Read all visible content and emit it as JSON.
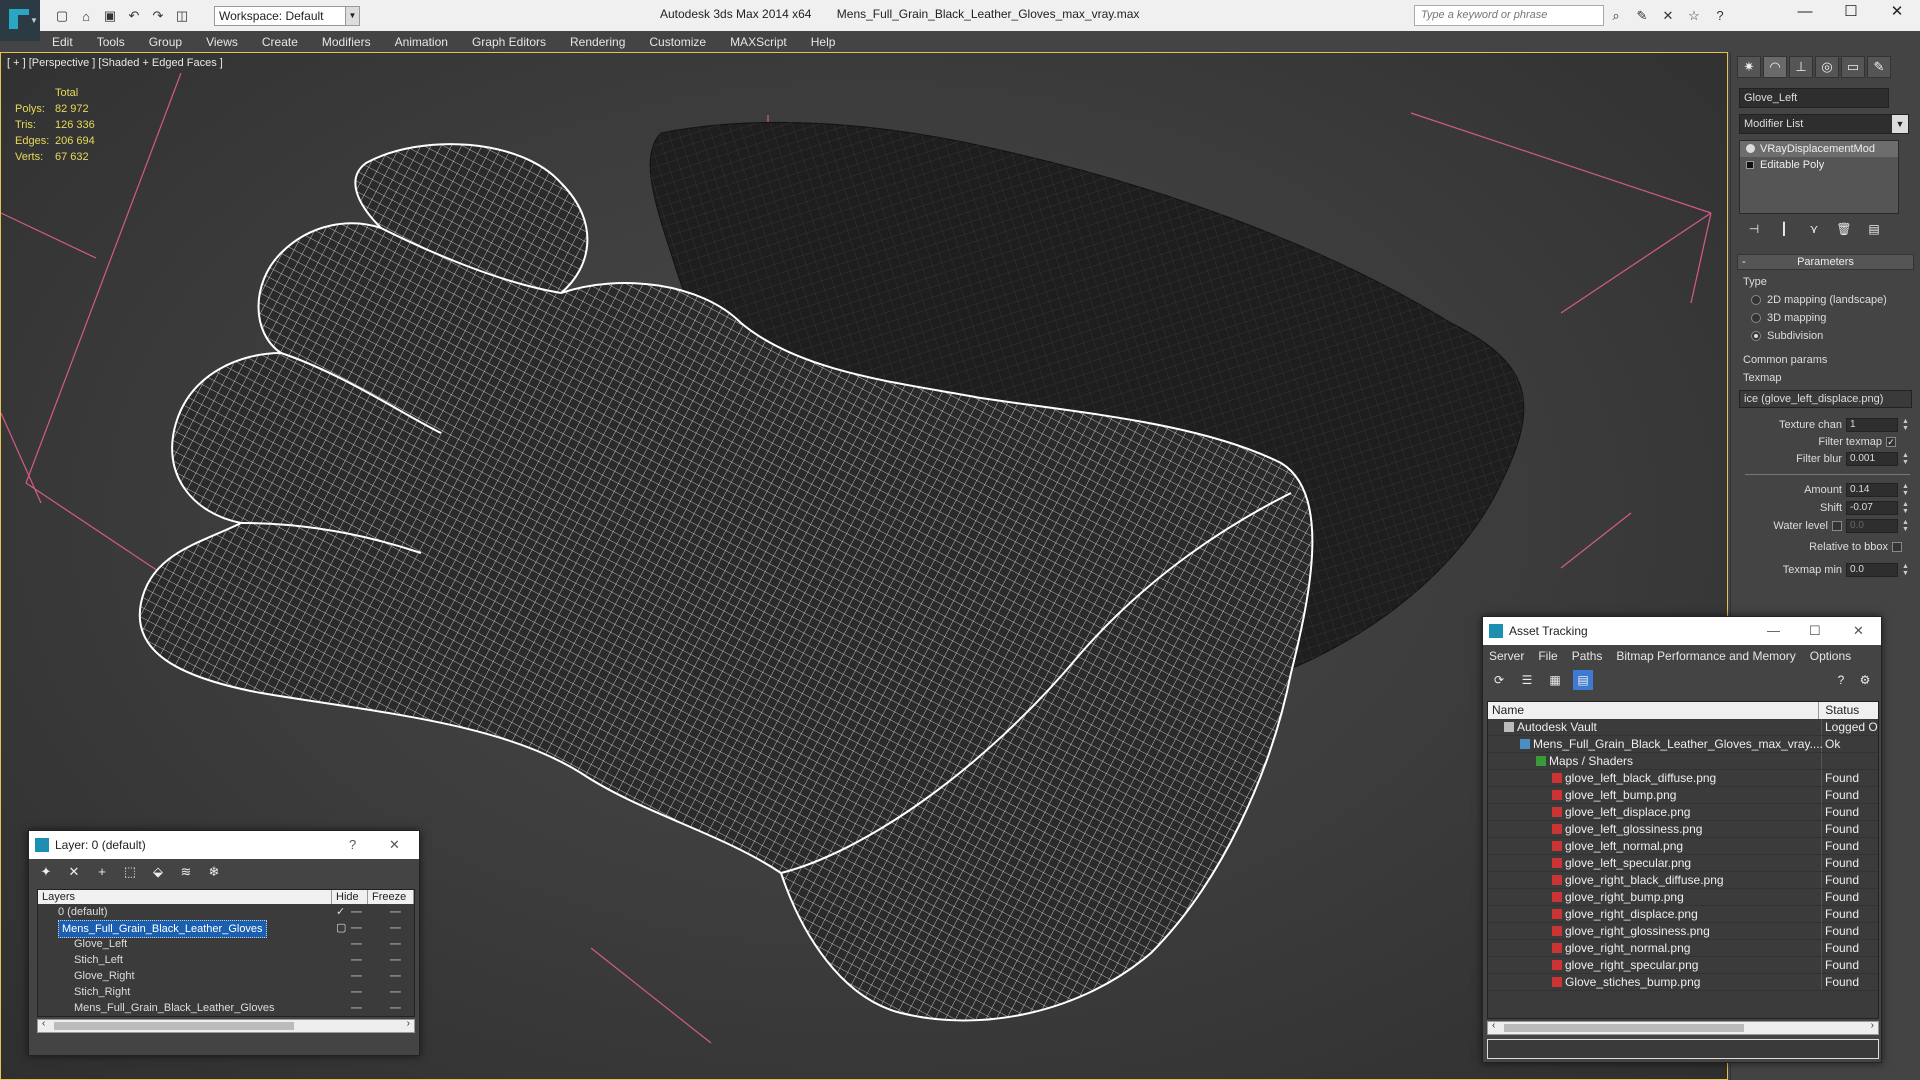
{
  "titlebar": {
    "workspace": "Workspace: Default",
    "app_name": "Autodesk 3ds Max  2014 x64",
    "file_name": "Mens_Full_Grain_Black_Leather_Gloves_max_vray.max",
    "search_placeholder": "Type a keyword or phrase"
  },
  "menu": [
    "Edit",
    "Tools",
    "Group",
    "Views",
    "Create",
    "Modifiers",
    "Animation",
    "Graph Editors",
    "Rendering",
    "Customize",
    "MAXScript",
    "Help"
  ],
  "viewport": {
    "label": "[ + ] [Perspective ] [Shaded + Edged Faces ]",
    "stats_header": "Total",
    "stats": [
      {
        "label": "Polys:",
        "value": "82 972"
      },
      {
        "label": "Tris:",
        "value": "126 336"
      },
      {
        "label": "Edges:",
        "value": "206 694"
      },
      {
        "label": "Verts:",
        "value": "67 632"
      }
    ]
  },
  "command_panel": {
    "object_name": "Glove_Left",
    "modifier_list": "Modifier List",
    "stack": [
      "VRayDisplacementMod",
      "Editable Poly"
    ],
    "parameters_title": "Parameters",
    "type_label": "Type",
    "type_options": [
      "2D mapping (landscape)",
      "3D mapping",
      "Subdivision"
    ],
    "common_params": "Common params",
    "texmap_label": "Texmap",
    "texmap_value": "ice (glove_left_displace.png)",
    "texture_chan_label": "Texture chan",
    "texture_chan_value": "1",
    "filter_texmap_label": "Filter texmap",
    "filter_blur_label": "Filter blur",
    "filter_blur_value": "0.001",
    "amount_label": "Amount",
    "amount_value": "0.14",
    "shift_label": "Shift",
    "shift_value": "-0.07",
    "water_level_label": "Water level",
    "water_level_value": "0.0",
    "relative_bbox_label": "Relative to bbox",
    "texmap_min_label": "Texmap min",
    "texmap_min_value": "0.0"
  },
  "layer_dialog": {
    "title": "Layer: 0 (default)",
    "help": "?",
    "columns": [
      "Layers",
      "Hide",
      "Freeze"
    ],
    "rows": [
      {
        "name": "0 (default)",
        "indent": 1
      },
      {
        "name": "Mens_Full_Grain_Black_Leather_Gloves",
        "indent": 1
      },
      {
        "name": "Glove_Left",
        "indent": 2
      },
      {
        "name": "Stich_Left",
        "indent": 2
      },
      {
        "name": "Glove_Right",
        "indent": 2
      },
      {
        "name": "Stich_Right",
        "indent": 2
      },
      {
        "name": "Mens_Full_Grain_Black_Leather_Gloves",
        "indent": 2
      }
    ]
  },
  "asset_dialog": {
    "title": "Asset Tracking",
    "menu": [
      "Server",
      "File",
      "Paths",
      "Bitmap Performance and Memory",
      "Options"
    ],
    "columns": [
      "Name",
      "Status"
    ],
    "rows": [
      {
        "name": "Autodesk Vault",
        "status": "Logged Ou",
        "icon": "vault",
        "indent": 1
      },
      {
        "name": "Mens_Full_Grain_Black_Leather_Gloves_max_vray....",
        "status": "Ok",
        "icon": "max",
        "indent": 2
      },
      {
        "name": "Maps / Shaders",
        "status": "",
        "icon": "map",
        "indent": 3
      },
      {
        "name": "glove_left_black_diffuse.png",
        "status": "Found",
        "icon": "png",
        "indent": 4
      },
      {
        "name": "glove_left_bump.png",
        "status": "Found",
        "icon": "png",
        "indent": 4
      },
      {
        "name": "glove_left_displace.png",
        "status": "Found",
        "icon": "png",
        "indent": 4
      },
      {
        "name": "glove_left_glossiness.png",
        "status": "Found",
        "icon": "png",
        "indent": 4
      },
      {
        "name": "glove_left_normal.png",
        "status": "Found",
        "icon": "png",
        "indent": 4
      },
      {
        "name": "glove_left_specular.png",
        "status": "Found",
        "icon": "png",
        "indent": 4
      },
      {
        "name": "glove_right_black_diffuse.png",
        "status": "Found",
        "icon": "png",
        "indent": 4
      },
      {
        "name": "glove_right_bump.png",
        "status": "Found",
        "icon": "png",
        "indent": 4
      },
      {
        "name": "glove_right_displace.png",
        "status": "Found",
        "icon": "png",
        "indent": 4
      },
      {
        "name": "glove_right_glossiness.png",
        "status": "Found",
        "icon": "png",
        "indent": 4
      },
      {
        "name": "glove_right_normal.png",
        "status": "Found",
        "icon": "png",
        "indent": 4
      },
      {
        "name": "glove_right_specular.png",
        "status": "Found",
        "icon": "png",
        "indent": 4
      },
      {
        "name": "Glove_stiches_bump.png",
        "status": "Found",
        "icon": "png",
        "indent": 4
      }
    ]
  },
  "colors": {
    "viewport_border": "#e0c550",
    "stats_text": "#e8d85c",
    "selection": "#1b5fb0",
    "wire": "#ffffff",
    "pink_grid": "#d45a8a"
  }
}
